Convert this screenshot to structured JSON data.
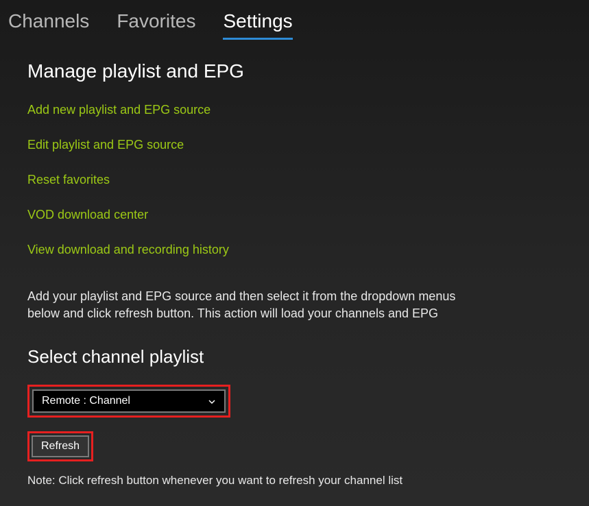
{
  "tabs": {
    "channels": "Channels",
    "favorites": "Favorites",
    "settings": "Settings"
  },
  "settings": {
    "heading": "Manage playlist and EPG",
    "links": {
      "add_source": "Add new playlist and EPG source",
      "edit_source": "Edit playlist and EPG source",
      "reset_favorites": "Reset favorites",
      "vod_center": "VOD download center",
      "view_history": "View download and recording history"
    },
    "description": "Add your playlist and EPG source and then select it from the dropdown menus below and click refresh button. This action will load your channels and EPG",
    "select_heading": "Select channel playlist",
    "dropdown_value": "Remote : Channel",
    "refresh_label": "Refresh",
    "note": "Note: Click refresh button whenever you want to refresh your channel list"
  },
  "colors": {
    "accent_green": "#9cc915",
    "accent_blue": "#2e8bd6",
    "highlight_red": "#e62020"
  }
}
